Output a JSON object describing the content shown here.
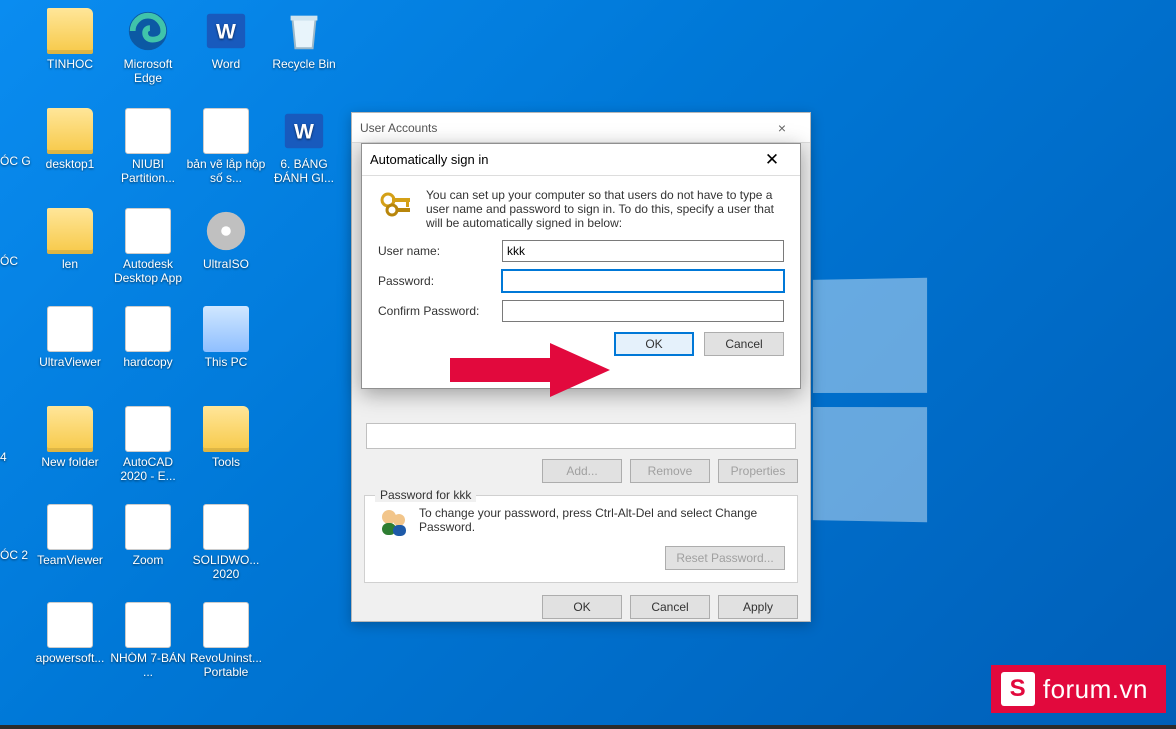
{
  "desktop_icons": [
    [
      {
        "label": "TINHOC",
        "kind": "folder"
      },
      {
        "label": "Microsoft Edge",
        "kind": "edge"
      },
      {
        "label": "Word",
        "kind": "word"
      },
      {
        "label": "Recycle Bin",
        "kind": "bin"
      }
    ],
    [
      {
        "label": "desktop1",
        "kind": "folder"
      },
      {
        "label": "NIUBI Partition...",
        "kind": "app"
      },
      {
        "label": "bản vẽ lắp hộp số s...",
        "kind": "doc"
      },
      {
        "label": "6. BẢNG ĐÁNH GI...",
        "kind": "word"
      }
    ],
    [
      {
        "label": "len",
        "kind": "folder"
      },
      {
        "label": "Autodesk Desktop App",
        "kind": "app"
      },
      {
        "label": "UltraISO",
        "kind": "disc"
      }
    ],
    [
      {
        "label": "UltraViewer",
        "kind": "app"
      },
      {
        "label": "hardcopy",
        "kind": "doc"
      },
      {
        "label": "This PC",
        "kind": "thispc"
      }
    ],
    [
      {
        "label": "New folder",
        "kind": "folder"
      },
      {
        "label": "AutoCAD 2020 - E...",
        "kind": "app"
      },
      {
        "label": "Tools",
        "kind": "folder"
      }
    ],
    [
      {
        "label": "TeamViewer",
        "kind": "app"
      },
      {
        "label": "Zoom",
        "kind": "app"
      },
      {
        "label": "SOLIDWO... 2020",
        "kind": "app"
      }
    ],
    [
      {
        "label": "apowersoft...",
        "kind": "app"
      },
      {
        "label": "NHÓM 7-BẢN ...",
        "kind": "doc"
      },
      {
        "label": "RevoUninst... Portable",
        "kind": "app"
      }
    ]
  ],
  "edge_col_labels": [
    "ÓC G",
    "ÓC",
    "4",
    "ÓC 2"
  ],
  "parent_window": {
    "title": "User Accounts",
    "buttons": {
      "add": "Add...",
      "remove": "Remove",
      "properties": "Properties"
    },
    "group_label": "Password for kkk",
    "pw_text": "To change your password, press Ctrl-Alt-Del and select Change Password.",
    "reset": "Reset Password...",
    "bottom": {
      "ok": "OK",
      "cancel": "Cancel",
      "apply": "Apply"
    }
  },
  "child_window": {
    "title": "Automatically sign in",
    "desc": "You can set up your computer so that users do not have to type a user name and password to sign in. To do this, specify a user that will be automatically signed in below:",
    "labels": {
      "user": "User name:",
      "pw": "Password:",
      "confirm": "Confirm Password:"
    },
    "values": {
      "user": "kkk",
      "pw": "",
      "confirm": ""
    },
    "buttons": {
      "ok": "OK",
      "cancel": "Cancel"
    }
  },
  "watermark": "forum.vn",
  "watermark_s": "S"
}
